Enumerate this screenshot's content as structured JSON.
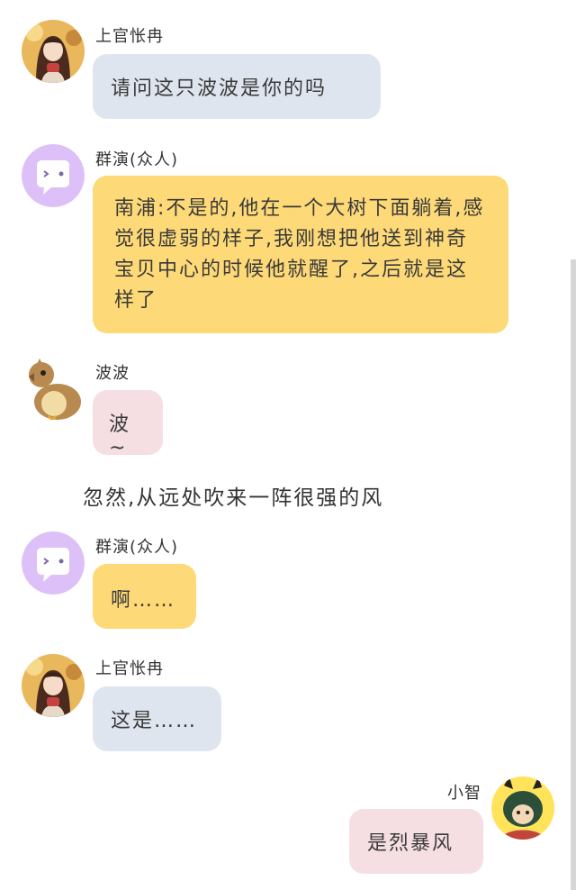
{
  "colors": {
    "bubble_blue": "#dfe5ee",
    "bubble_yellow": "#fdd977",
    "bubble_pink": "#f5dfe2",
    "crowd_avatar_bg": "#dcc0f7"
  },
  "messages": [
    {
      "sender": "上官怅冉",
      "avatar": "anime-girl-avatar",
      "text": "请问这只波波是你的吗"
    },
    {
      "sender": "群演(众人)",
      "avatar": "chat-bubble-avatar",
      "text": "南浦:不是的,他在一个大树下面躺着,感觉很虚弱的样子,我刚想把他送到神奇宝贝中心的时候他就醒了,之后就是这样了"
    },
    {
      "sender": "波波",
      "avatar": "pidgey-avatar",
      "text": "波~"
    },
    {
      "sender": "群演(众人)",
      "avatar": "chat-bubble-avatar",
      "text": "啊……"
    },
    {
      "sender": "上官怅冉",
      "avatar": "anime-girl-avatar",
      "text": "这是……"
    },
    {
      "sender": "小智",
      "avatar": "pikachu-hood-avatar",
      "text": "是烈暴风"
    }
  ],
  "narration": "忽然,从远处吹来一阵很强的风"
}
